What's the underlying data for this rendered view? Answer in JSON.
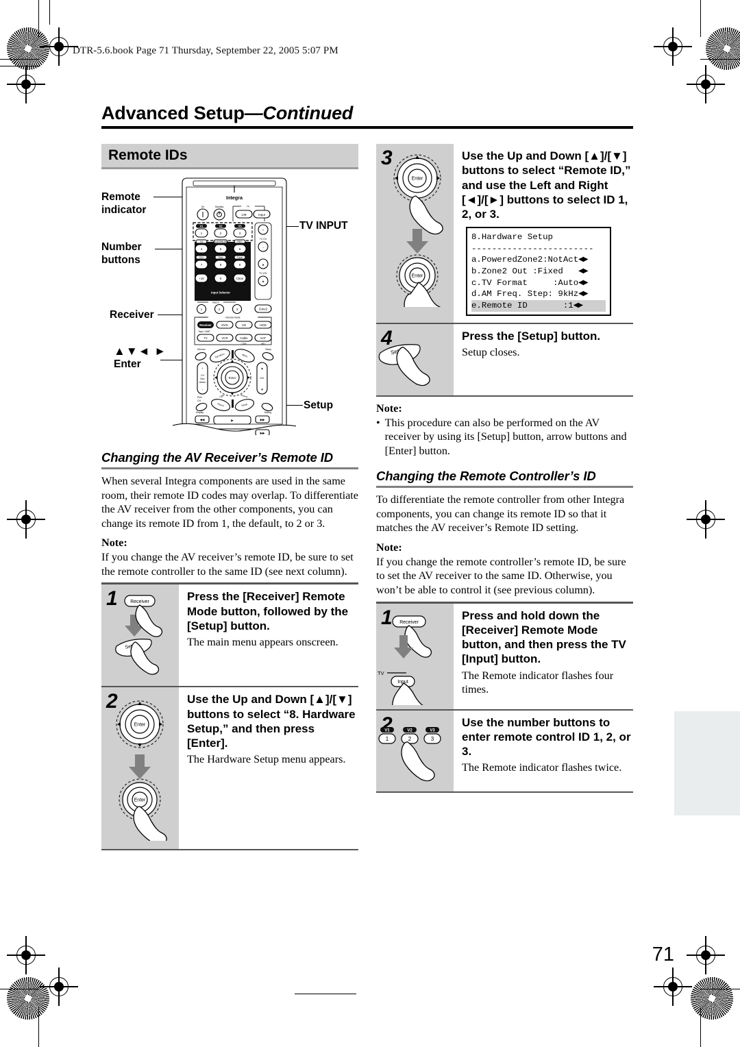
{
  "header": {
    "book_line": "DTR-5.6.book  Page 71  Thursday, September 22, 2005  5:07 PM"
  },
  "page": {
    "title_main": "Advanced Setup",
    "title_continued": "—Continued",
    "page_number": "71"
  },
  "section": {
    "bar_title": "Remote IDs"
  },
  "remote_diagram": {
    "brand": "Integra",
    "callouts": {
      "remote_indicator": "Remote\nindicator",
      "remote_indicator_l1": "Remote",
      "remote_indicator_l2": "indicator",
      "number_buttons_l1": "Number",
      "number_buttons_l2": "buttons",
      "receiver": "Receiver",
      "arrows_enter_l1": "▲▼◄ ►",
      "arrows_enter_l2": "Enter",
      "tv_input": "TV INPUT",
      "setup": "Setup"
    },
    "buttons": {
      "on": "On",
      "standby": "Standby",
      "tv_group": "TV",
      "tv_power": "1/ɔ",
      "tv_input": "Input",
      "numbers": [
        "1",
        "2",
        "3",
        "4",
        "5",
        "6",
        "7",
        "8",
        "9",
        "+10",
        "0",
        "Clear"
      ],
      "number_shift_labels": [
        "V1",
        "V2",
        "V3",
        "V4",
        "PLAY/PAUSE",
        "REC",
        "CH +",
        "Stop",
        "Tuner"
      ],
      "tv_ch": "TV CH",
      "tv_vol": "TV VOL",
      "input_selector": "Input Selector",
      "macro": "Macro",
      "macro_items": [
        "1",
        "2",
        "3"
      ],
      "zone2": "Zone2",
      "remote_mode": "Remote Mode",
      "mode_row1": [
        "Receiver",
        "DVD",
        "CD",
        "HDD"
      ],
      "mode_row1_sub": "Tape / AMP",
      "mode_row2": [
        "TV",
        "VCR",
        "Cable",
        "SAT"
      ],
      "mode_row2_sub_cable": "CDR",
      "mode_row2_sub_sat": "MD",
      "dimmer": "Dimmer",
      "sleep": "Sleep",
      "top_menu": "Top Menu",
      "menu": "Menu",
      "ch": "CH",
      "disc": "Disc",
      "album": "Album",
      "vol": "VOL",
      "enter": "Enter",
      "prev_ch_l1": "Prev",
      "prev_ch_l2": "CH",
      "return": "Return",
      "setup": "Setup",
      "display": "Display",
      "muting": "Muting",
      "light": "Light",
      "search": "Search"
    }
  },
  "left_column": {
    "subhead": "Changing the AV Receiver’s Remote ID",
    "paragraph": "When several Integra components are used in the same room, their remote ID codes may overlap. To differentiate the AV receiver from the other components, you can change its remote ID from 1, the default, to 2 or 3.",
    "note_label": "Note:",
    "note_text": "If you change the AV receiver’s remote ID, be sure to set the remote controller to the same ID (see next column).",
    "steps": [
      {
        "number": "1",
        "heading": "Press the [Receiver] Remote Mode button, followed by the [Setup] button.",
        "sub": "The main menu appears onscreen.",
        "fig_labels": [
          "Receiver",
          "Setup"
        ]
      },
      {
        "number": "2",
        "heading": "Use the Up and Down [▲]/[▼] buttons to select “8. Hardware Setup,” and then press [Enter].",
        "sub": "The Hardware Setup menu appears.",
        "fig_labels": [
          "Enter",
          "Enter"
        ]
      }
    ]
  },
  "right_column": {
    "steps_top": [
      {
        "number": "3",
        "heading": "Use the Up and Down [▲]/[▼] buttons to select “Remote ID,” and use the Left and Right [◄]/[►] buttons to select ID 1, 2, or 3.",
        "sub": "",
        "fig_labels": [
          "Enter"
        ]
      },
      {
        "number": "4",
        "heading": "Press the [Setup] button.",
        "sub": "Setup closes.",
        "fig_labels": [
          "Setup"
        ]
      }
    ],
    "note_label": "Note:",
    "note_bullet": "This procedure can also be performed on the AV receiver by using its [Setup] button, arrow buttons and [Enter] button.",
    "subhead": "Changing the Remote Controller’s ID",
    "paragraph": "To differentiate the remote controller from other Integra components, you can change its remote ID so that it matches the AV receiver’s Remote ID setting.",
    "note2_label": "Note:",
    "note2_text": "If you change the remote controller’s remote ID, be sure to set the AV receiver to the same ID. Otherwise, you won’t be able to control it (see previous column).",
    "steps_bottom": [
      {
        "number": "1",
        "heading": "Press and hold down the [Receiver] Remote Mode button, and then press the TV [Input] button.",
        "sub": "The Remote indicator flashes four times.",
        "fig_labels": [
          "Receiver",
          "TV",
          "Input"
        ]
      },
      {
        "number": "2",
        "heading": "Use the number buttons to enter remote control ID 1, 2, or 3.",
        "sub": "The Remote indicator flashes twice.",
        "fig_labels": [
          "1",
          "2",
          "3"
        ],
        "fig_shift_labels": [
          "V1",
          "V2",
          "V3"
        ]
      }
    ]
  },
  "lcd_menu": {
    "title": "8.Hardware Setup",
    "divider": "------------------------",
    "rows": [
      {
        "text": "a.PoweredZone2:NotAct",
        "arrows": true,
        "selected": false
      },
      {
        "text": "b.Zone2 Out :Fixed   ",
        "arrows": true,
        "selected": false
      },
      {
        "text": "c.TV Format     :Auto",
        "arrows": true,
        "selected": false
      },
      {
        "text": "d.AM Freq. Step: 9kHz",
        "arrows": true,
        "selected": false
      },
      {
        "text": "e.Remote ID       :1",
        "arrows": true,
        "selected": true
      }
    ]
  },
  "colors": {
    "panel_gray": "#cfcfcf",
    "bar_gray": "#cfcfcf",
    "rule_gray": "#808080",
    "thumb_tab": "#e9eded",
    "text": "#000000"
  }
}
